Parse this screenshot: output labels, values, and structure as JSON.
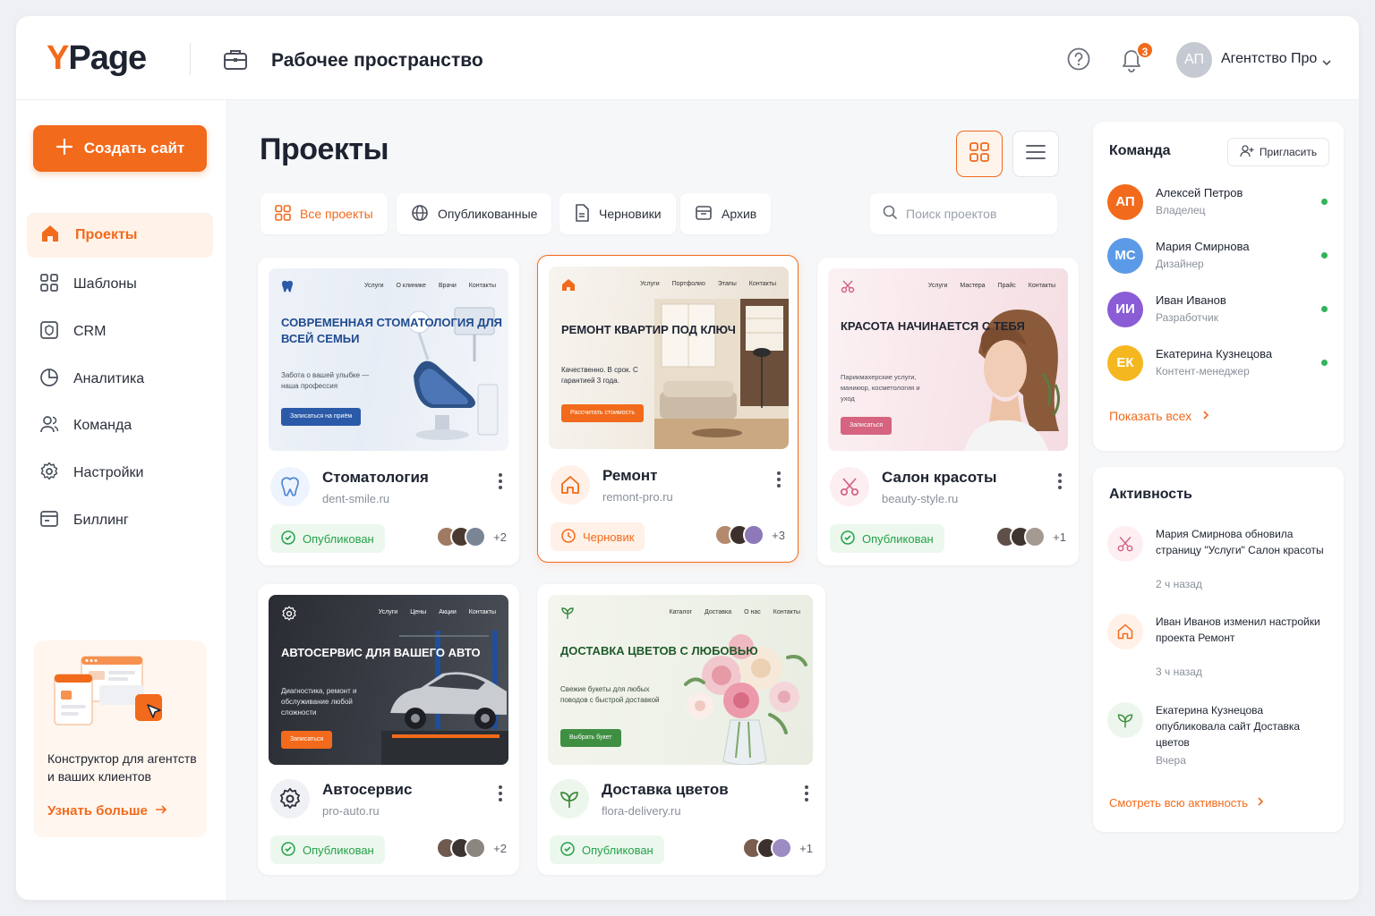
{
  "header": {
    "logo_y": "Y",
    "logo_rest": "Page",
    "workspace_title": "Рабочее пространство",
    "notifications_count": "3",
    "user_initials": "АП",
    "user_name": "Агентство Про"
  },
  "sidebar": {
    "create_label": "Создать сайт",
    "items": [
      {
        "label": "Проекты",
        "icon": "home-icon",
        "active": true
      },
      {
        "label": "Шаблоны",
        "icon": "grid-icon"
      },
      {
        "label": "CRM",
        "icon": "crm-icon"
      },
      {
        "label": "Аналитика",
        "icon": "pie-chart-icon"
      },
      {
        "label": "Команда",
        "icon": "users-icon"
      },
      {
        "label": "Настройки",
        "icon": "gear-icon"
      },
      {
        "label": "Биллинг",
        "icon": "billing-icon"
      }
    ],
    "promo": {
      "text": "Конструктор для агентств и ваших клиентов",
      "link": "Узнать больше"
    }
  },
  "main": {
    "title": "Проекты",
    "tabs": [
      {
        "label": "Все проекты",
        "active": true
      },
      {
        "label": "Опубликованные"
      },
      {
        "label": "Черновики"
      },
      {
        "label": "Архив"
      }
    ],
    "search_placeholder": "Поиск проектов",
    "projects": [
      {
        "name": "Стоматология",
        "url": "dent-smile.ru",
        "status": "Опубликован",
        "extra_members": "+2",
        "thumb": {
          "nav": [
            "Услуги",
            "О клинике",
            "Врачи",
            "Контакты"
          ],
          "headline": "СОВРЕМЕННАЯ СТОМАТОЛОГИЯ ДЛЯ ВСЕЙ СЕМЬИ",
          "sub": "Забота о вашей улыбке — наша профессия",
          "button": "Записаться на приём"
        }
      },
      {
        "name": "Ремонт",
        "url": "remont-pro.ru",
        "status": "Черновик",
        "extra_members": "+3",
        "thumb": {
          "nav": [
            "Услуги",
            "Портфолио",
            "Этапы",
            "Контакты"
          ],
          "headline": "РЕМОНТ КВАРТИР ПОД КЛЮЧ",
          "sub": "Качественно. В срок. С гарантией 3 года.",
          "button": "Рассчитать стоимость"
        }
      },
      {
        "name": "Салон красоты",
        "url": "beauty-style.ru",
        "status": "Опубликован",
        "extra_members": "+1",
        "thumb": {
          "nav": [
            "Услуги",
            "Мастера",
            "Прайс",
            "Контакты"
          ],
          "headline": "КРАСОТА НАЧИНАЕТСЯ С ТЕБЯ",
          "sub": "Парикмахерские услуги, маникюр, косметология и уход",
          "button": "Записаться"
        }
      },
      {
        "name": "Автосервис",
        "url": "pro-auto.ru",
        "status": "Опубликован",
        "extra_members": "+2",
        "thumb": {
          "nav": [
            "Услуги",
            "Цены",
            "Акции",
            "Контакты"
          ],
          "headline": "АВТОСЕРВИС ДЛЯ ВАШЕГО АВТО",
          "sub": "Диагностика, ремонт и обслуживание любой сложности",
          "button": "Записаться"
        }
      },
      {
        "name": "Доставка цветов",
        "url": "flora-delivery.ru",
        "status": "Опубликован",
        "extra_members": "+1",
        "thumb": {
          "nav": [
            "Каталог",
            "Доставка",
            "О нас",
            "Контакты"
          ],
          "headline": "ДОСТАВКА ЦВЕТОВ С ЛЮБОВЬЮ",
          "sub": "Свежие букеты для любых поводов с быстрой доставкой",
          "button": "Выбрать букет"
        }
      }
    ]
  },
  "team": {
    "title": "Команда",
    "invite_label": "Пригласить",
    "members": [
      {
        "initials": "АП",
        "name": "Алексей Петров",
        "role": "Владелец",
        "color": "#f26a1b"
      },
      {
        "initials": "МС",
        "name": "Мария Смирнова",
        "role": "Дизайнер",
        "color": "#5b9ae6"
      },
      {
        "initials": "ИИ",
        "name": "Иван Иванов",
        "role": "Разработчик",
        "color": "#8a5cd6"
      },
      {
        "initials": "ЕК",
        "name": "Екатерина Кузнецова",
        "role": "Контент-менеджер",
        "color": "#f5b720"
      }
    ],
    "show_all": "Показать всех"
  },
  "activity": {
    "title": "Активность",
    "items": [
      {
        "text": "Мария Смирнова обновила страницу \"Услуги\" Салон красоты",
        "time": "2 ч назад",
        "icon": "scissors-icon"
      },
      {
        "text": "Иван Иванов изменил настройки проекта Ремонт",
        "time": "3 ч назад",
        "icon": "home-icon"
      },
      {
        "text": "Екатерина Кузнецова опубликовала сайт Доставка цветов",
        "time": "Вчера",
        "icon": "leaf-icon"
      }
    ],
    "all_label": "Смотреть всю активность"
  },
  "colors": {
    "accent": "#f26a1b",
    "published": "#27a04a"
  }
}
